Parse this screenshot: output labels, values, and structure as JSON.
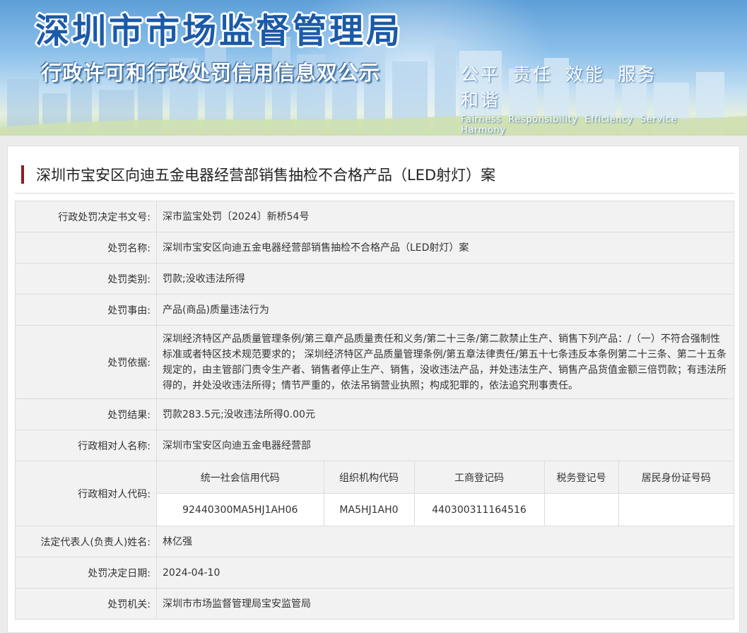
{
  "banner": {
    "title": "深圳市市场监督管理局",
    "subtitle": "行政许可和行政处罚信用信息双公示",
    "slogan_zh": [
      "公平",
      "责任",
      "效能",
      "服务",
      "和谐"
    ],
    "slogan_en": [
      "Fairness",
      "Responsibility",
      "Efficiency",
      "Service",
      "Harmony"
    ]
  },
  "case_title": "深圳市宝安区向迪五金电器经营部销售抽检不合格产品（LED射灯）案",
  "rows": {
    "doc_no": {
      "label": "行政处罚决定书文号:",
      "value": "深市监宝处罚〔2024〕新桥54号"
    },
    "name": {
      "label": "处罚名称:",
      "value": "深圳市宝安区向迪五金电器经营部销售抽检不合格产品（LED射灯）案"
    },
    "category": {
      "label": "处罚类别:",
      "value": "罚款;没收违法所得"
    },
    "reason": {
      "label": "处罚事由:",
      "value": "产品(商品)质量违法行为"
    },
    "basis": {
      "label": "处罚依据:",
      "value": "深圳经济特区产品质量管理条例/第三章产品质量责任和义务/第二十三条/第二款禁止生产、销售下列产品：/（一）不符合强制性标准或者特区技术规范要求的； 深圳经济特区产品质量管理条例/第五章法律责任/第五十七条违反本条例第二十三条、第二十五条规定的，由主管部门责令生产者、销售者停止生产、销售，没收违法产品，并处违法生产、销售产品货值金额三倍罚款；有违法所得的，并处没收违法所得；情节严重的，依法吊销营业执照；构成犯罪的，依法追究刑事责任。"
    },
    "result": {
      "label": "处罚结果:",
      "value": "罚款283.5元;没收违法所得0.00元"
    },
    "party_name": {
      "label": "行政相对人名称:",
      "value": "深圳市宝安区向迪五金电器经营部"
    },
    "party_code": {
      "label": "行政相对人代码:",
      "headers": [
        "统一社会信用代码",
        "组织机构代码",
        "工商登记码",
        "税务登记号",
        "居民身份证号码"
      ],
      "values": [
        "92440300MA5HJ1AH06",
        "MA5HJ1AH0",
        "440300311164516",
        "",
        ""
      ]
    },
    "legal_rep": {
      "label": "法定代表人(负责人)姓名:",
      "value": "林亿强"
    },
    "date": {
      "label": "处罚决定日期:",
      "value": "2024-04-10"
    },
    "authority": {
      "label": "处罚机关:",
      "value": "深圳市市场监督管理局宝安监管局"
    }
  },
  "colors": {
    "title_blue": "#1b5aa8",
    "accent_bar": "#8f1d1d",
    "row_shade": "#f2f2f2"
  }
}
